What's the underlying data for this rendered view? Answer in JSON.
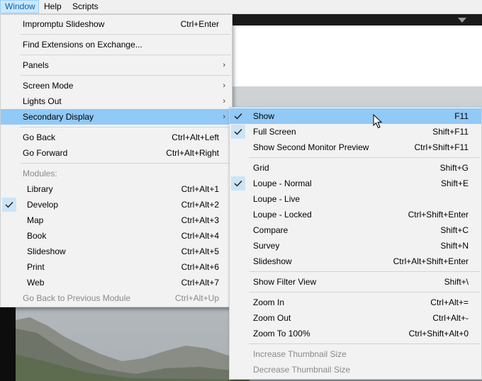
{
  "menubar": {
    "items": [
      {
        "label": "Window",
        "active": true
      },
      {
        "label": "Help",
        "active": false
      },
      {
        "label": "Scripts",
        "active": false
      }
    ]
  },
  "window_menu": {
    "items": [
      {
        "label": "Impromptu Slideshow",
        "shortcut": "Ctrl+Enter"
      },
      {
        "label": "Find Extensions on Exchange...",
        "shortcut": ""
      },
      {
        "label": "Panels",
        "shortcut": "",
        "submenu": true
      },
      {
        "label": "Screen Mode",
        "shortcut": "",
        "submenu": true
      },
      {
        "label": "Lights Out",
        "shortcut": "",
        "submenu": true
      },
      {
        "label": "Secondary Display",
        "shortcut": "",
        "submenu": true,
        "highlighted": true
      },
      {
        "label": "Go Back",
        "shortcut": "Ctrl+Alt+Left"
      },
      {
        "label": "Go Forward",
        "shortcut": "Ctrl+Alt+Right"
      },
      {
        "label": "Modules:",
        "shortcut": "",
        "disabled": true
      },
      {
        "label": "Library",
        "shortcut": "Ctrl+Alt+1"
      },
      {
        "label": "Develop",
        "shortcut": "Ctrl+Alt+2",
        "checked": true
      },
      {
        "label": "Map",
        "shortcut": "Ctrl+Alt+3"
      },
      {
        "label": "Book",
        "shortcut": "Ctrl+Alt+4"
      },
      {
        "label": "Slideshow",
        "shortcut": "Ctrl+Alt+5"
      },
      {
        "label": "Print",
        "shortcut": "Ctrl+Alt+6"
      },
      {
        "label": "Web",
        "shortcut": "Ctrl+Alt+7"
      },
      {
        "label": "Go Back to Previous Module",
        "shortcut": "Ctrl+Alt+Up",
        "disabled": true
      }
    ]
  },
  "secondary_menu": {
    "items": [
      {
        "label": "Show",
        "shortcut": "F11",
        "checked": true,
        "highlighted": true
      },
      {
        "label": "Full Screen",
        "shortcut": "Shift+F11",
        "checked": true
      },
      {
        "label": "Show Second Monitor Preview",
        "shortcut": "Ctrl+Shift+F11"
      },
      {
        "label": "Grid",
        "shortcut": "Shift+G"
      },
      {
        "label": "Loupe - Normal",
        "shortcut": "Shift+E",
        "checked": true
      },
      {
        "label": "Loupe - Live",
        "shortcut": ""
      },
      {
        "label": "Loupe - Locked",
        "shortcut": "Ctrl+Shift+Enter"
      },
      {
        "label": "Compare",
        "shortcut": "Shift+C"
      },
      {
        "label": "Survey",
        "shortcut": "Shift+N"
      },
      {
        "label": "Slideshow",
        "shortcut": "Ctrl+Alt+Shift+Enter"
      },
      {
        "label": "Show Filter View",
        "shortcut": "Shift+\\"
      },
      {
        "label": "Zoom In",
        "shortcut": "Ctrl+Alt+="
      },
      {
        "label": "Zoom Out",
        "shortcut": "Ctrl+Alt+-"
      },
      {
        "label": "Zoom To 100%",
        "shortcut": "Ctrl+Shift+Alt+0"
      },
      {
        "label": "Increase Thumbnail Size",
        "shortcut": "",
        "disabled": true
      },
      {
        "label": "Decrease Thumbnail Size",
        "shortcut": "",
        "disabled": true
      }
    ]
  },
  "colors": {
    "highlight": "#91c9f7",
    "menu_bg": "#f2f2f2",
    "check_bg": "#cce4f7",
    "disabled_text": "#8a8a8a"
  }
}
